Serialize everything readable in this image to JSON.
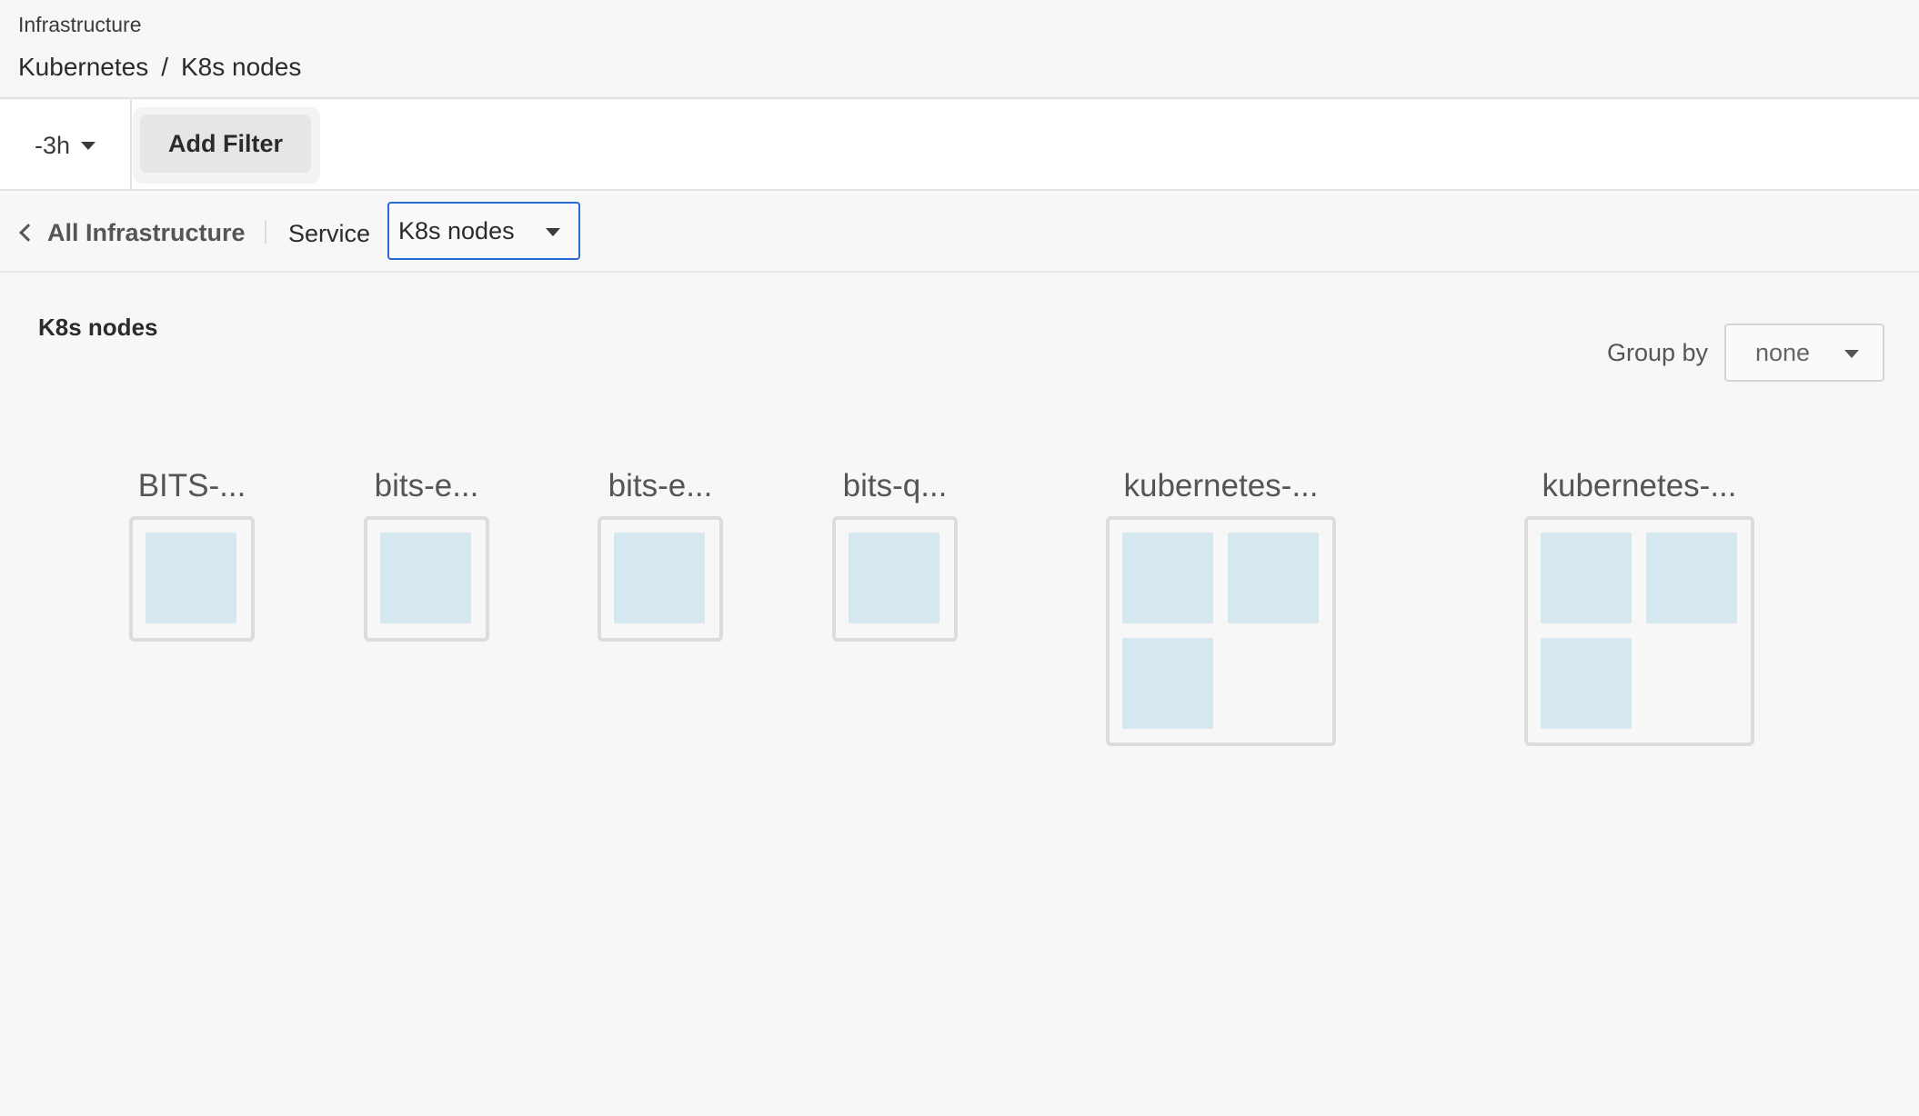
{
  "header": {
    "section": "Infrastructure",
    "breadcrumb": {
      "parent": "Kubernetes",
      "separator": "/",
      "current": "K8s nodes"
    }
  },
  "toolbar": {
    "time_range": "-3h",
    "add_filter_label": "Add Filter"
  },
  "navbar": {
    "back_label": "All Infrastructure",
    "service_label": "Service",
    "service_value": "K8s nodes"
  },
  "panel": {
    "title": "K8s nodes",
    "group_by_label": "Group by",
    "group_by_value": "none"
  },
  "nodes": [
    {
      "label": "BITS-...",
      "pods": 1
    },
    {
      "label": "bits-e...",
      "pods": 1
    },
    {
      "label": "bits-e...",
      "pods": 1
    },
    {
      "label": "bits-q...",
      "pods": 1
    },
    {
      "label": "kubernetes-...",
      "pods": 3
    },
    {
      "label": "kubernetes-...",
      "pods": 3
    }
  ],
  "colors": {
    "pod_fill": "#d5e8f0",
    "node_border": "#dcdcdc",
    "select_focus": "#2a6bd1"
  },
  "icons": {
    "time_dropdown": "chevron-down-icon",
    "back": "chevron-left-icon",
    "service_dropdown": "chevron-down-icon",
    "group_by_dropdown": "chevron-down-icon"
  }
}
